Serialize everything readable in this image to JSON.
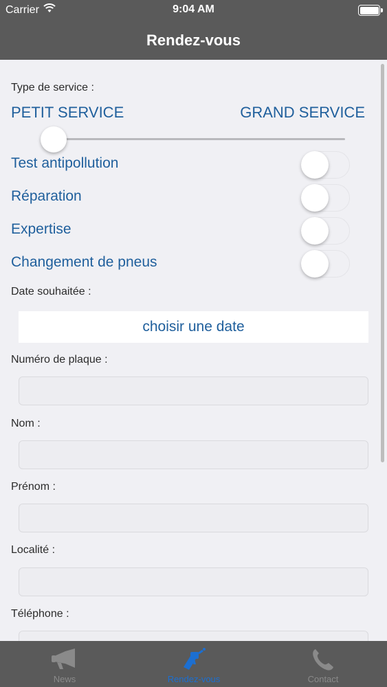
{
  "status": {
    "carrier": "Carrier",
    "time": "9:04 AM"
  },
  "nav": {
    "title": "Rendez-vous"
  },
  "form": {
    "service_type_label": "Type de service :",
    "service_left": "PETIT SERVICE",
    "service_right": "GRAND SERVICE",
    "service_slider_value": 0,
    "options": [
      {
        "label": "Test antipollution",
        "on": false
      },
      {
        "label": "Réparation",
        "on": false
      },
      {
        "label": "Expertise",
        "on": false
      },
      {
        "label": "Changement de pneus",
        "on": false
      }
    ],
    "date_label": "Date souhaitée :",
    "date_button": "choisir une date",
    "fields": {
      "plate_label": "Numéro de plaque :",
      "plate_value": "",
      "nom_label": "Nom :",
      "nom_value": "",
      "prenom_label": "Prénom :",
      "prenom_value": "",
      "localite_label": "Localité :",
      "localite_value": "",
      "telephone_label": "Téléphone :",
      "telephone_value": ""
    }
  },
  "tabs": [
    {
      "label": "News",
      "icon": "megaphone-icon",
      "active": false
    },
    {
      "label": "Rendez-vous",
      "icon": "spray-gun-icon",
      "active": true
    },
    {
      "label": "Contact",
      "icon": "phone-icon",
      "active": false
    }
  ],
  "colors": {
    "bar": "#5a5a5a",
    "accent": "#1f5f9c",
    "tab_active": "#1c6fd1",
    "tab_inactive": "#8a8a8a"
  }
}
